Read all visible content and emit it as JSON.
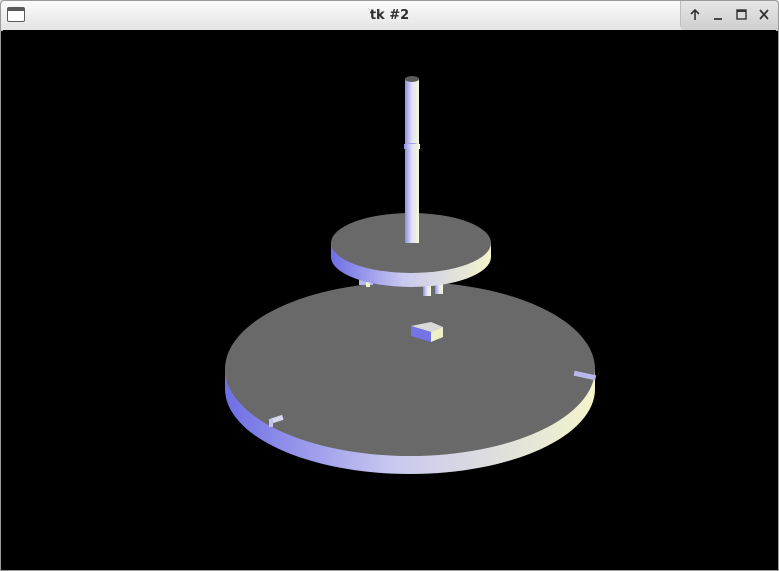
{
  "window": {
    "title": "tk #2"
  },
  "titlebar": {
    "icons": [
      "app-window-icon",
      "shade-up-icon",
      "minimize-icon",
      "maximize-icon",
      "close-icon"
    ]
  },
  "scene": {
    "background": "#000000",
    "disk_top_color": "#6a6a6a",
    "edge_gradient": [
      "#7a7ae8",
      "#c9c9f0",
      "#f4f4d0"
    ]
  }
}
